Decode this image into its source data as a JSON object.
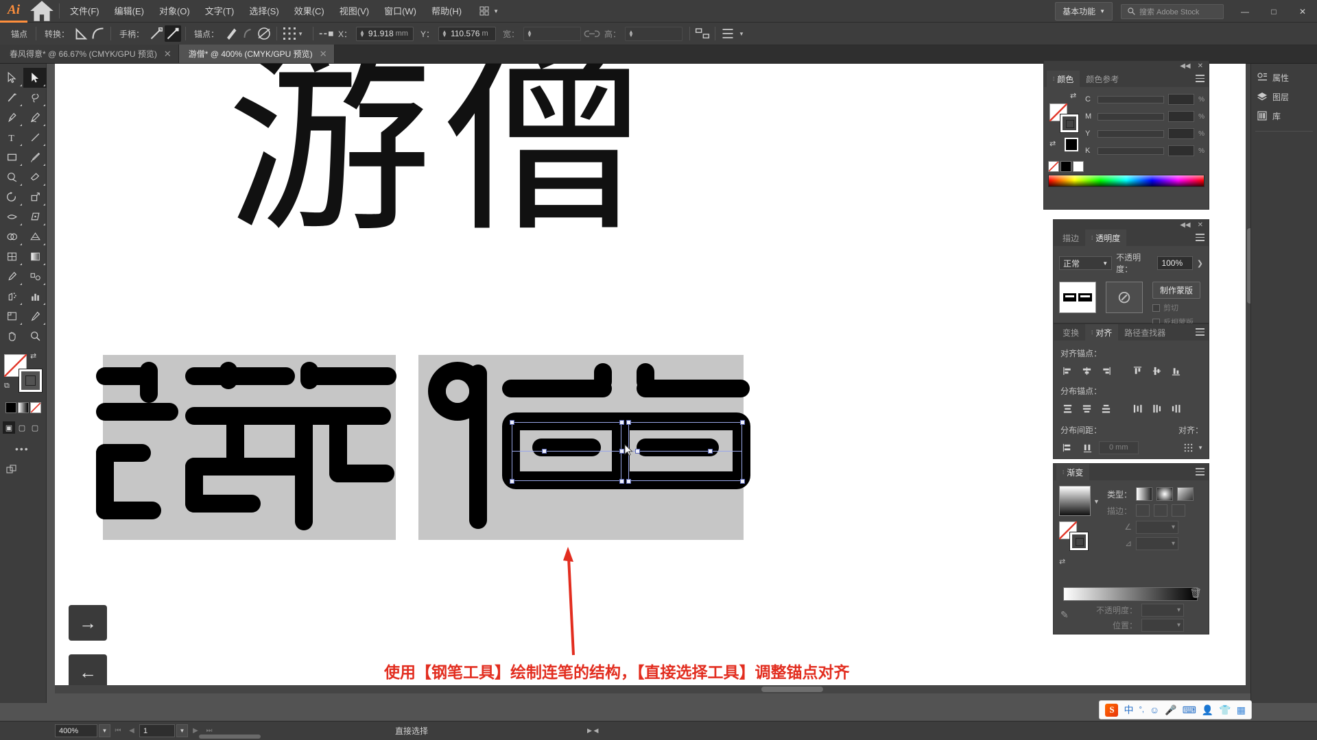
{
  "app": {
    "name": "Ai",
    "workspace": "基本功能",
    "stock_placeholder": "搜索 Adobe Stock"
  },
  "menubar": {
    "items": [
      {
        "label": "文件(F)"
      },
      {
        "label": "编辑(E)"
      },
      {
        "label": "对象(O)"
      },
      {
        "label": "文字(T)"
      },
      {
        "label": "选择(S)"
      },
      {
        "label": "效果(C)"
      },
      {
        "label": "视图(V)"
      },
      {
        "label": "窗口(W)"
      },
      {
        "label": "帮助(H)"
      }
    ],
    "home_icon": "home-icon",
    "grid_icon": "grid-icon",
    "minimize": "—",
    "maximize": "□",
    "close": "✕"
  },
  "controlbar": {
    "title": "锚点",
    "convert_label": "转换：",
    "handle_label": "手柄：",
    "anchor_label": "锚点：",
    "x_label": "X：",
    "x_value": "91.918",
    "x_unit": "mm",
    "y_label": "Y：",
    "y_value": "110.576",
    "y_unit": "m",
    "w_label": "宽：",
    "w_value": "",
    "h_label": "高：",
    "h_value": "",
    "icons": {
      "convert_corner": "convert-corner-icon",
      "convert_smooth": "convert-smooth-icon",
      "handle_show": "handle-show-icon",
      "handle_hide": "handle-hide-icon",
      "anchor_remove": "anchor-remove-icon",
      "anchor_connect": "anchor-connect-icon",
      "isolate": "isolate-icon",
      "align_grid": "align-grid-icon",
      "transform_ref": "transform-reference-icon",
      "link": "link-icon",
      "distribute": "distribute-icon",
      "more": "more-options-icon"
    }
  },
  "tabs": [
    {
      "label": "春风得意* @ 66.67% (CMYK/GPU 预览)",
      "active": false,
      "close": "✕"
    },
    {
      "label": "游僧* @ 400% (CMYK/GPU 预览)",
      "active": true,
      "close": "✕"
    }
  ],
  "toolbar": {
    "tools": [
      {
        "name": "selection-tool",
        "label": "选择工具"
      },
      {
        "name": "direct-selection-tool",
        "label": "直接选择工具",
        "selected": true
      },
      {
        "name": "magic-wand-tool",
        "label": "魔棒工具"
      },
      {
        "name": "lasso-tool",
        "label": "套索工具"
      },
      {
        "name": "pen-tool",
        "label": "钢笔工具"
      },
      {
        "name": "curvature-tool",
        "label": "曲率工具"
      },
      {
        "name": "type-tool",
        "label": "文字工具"
      },
      {
        "name": "line-segment-tool",
        "label": "直线段工具"
      },
      {
        "name": "rectangle-tool",
        "label": "矩形工具"
      },
      {
        "name": "paintbrush-tool",
        "label": "画笔工具"
      },
      {
        "name": "shaper-tool",
        "label": "Shaper 工具"
      },
      {
        "name": "eraser-tool",
        "label": "橡皮擦工具"
      },
      {
        "name": "rotate-tool",
        "label": "旋转工具"
      },
      {
        "name": "scale-tool",
        "label": "比例缩放工具"
      },
      {
        "name": "width-tool",
        "label": "宽度工具"
      },
      {
        "name": "free-transform-tool",
        "label": "自由变换工具"
      },
      {
        "name": "shape-builder-tool",
        "label": "形状生成器工具"
      },
      {
        "name": "perspective-grid-tool",
        "label": "透视网格工具"
      },
      {
        "name": "mesh-tool",
        "label": "网格工具"
      },
      {
        "name": "gradient-tool",
        "label": "渐变工具"
      },
      {
        "name": "eyedropper-tool",
        "label": "吸管工具"
      },
      {
        "name": "blend-tool",
        "label": "混合工具"
      },
      {
        "name": "symbol-sprayer-tool",
        "label": "符号喷枪工具"
      },
      {
        "name": "column-graph-tool",
        "label": "柱形图工具"
      },
      {
        "name": "artboard-tool",
        "label": "画板工具"
      },
      {
        "name": "slice-tool",
        "label": "切片工具"
      },
      {
        "name": "hand-tool",
        "label": "抓手工具"
      },
      {
        "name": "zoom-tool",
        "label": "缩放工具"
      }
    ],
    "fill_stroke": {
      "fill_name": "fill-swatch",
      "stroke_name": "stroke-swatch",
      "swap_icon": "swap-fill-stroke-icon",
      "default_icon": "default-fill-stroke-icon"
    },
    "color_modes": [
      "color-mode",
      "gradient-mode",
      "none-mode"
    ],
    "screen_modes": [
      "normal-screen-mode",
      "fullscreen-menubar-mode",
      "fullscreen-mode"
    ],
    "more_label": "•••"
  },
  "canvas": {
    "glyph_preview": "游僧",
    "artboard_color": "#c6c6c6",
    "caption": "使用【钢笔工具】绘制连笔的结构，【直接选择工具】调整锚点对齐",
    "caption_color": "#e22d1f",
    "arrow_color": "#e22d1f",
    "nav": {
      "next": "→",
      "prev": "←",
      "strip": [
        "→",
        "←",
        "←"
      ]
    }
  },
  "panels": {
    "color": {
      "tabs": [
        {
          "label": "颜色",
          "active": true
        },
        {
          "label": "颜色参考",
          "active": false
        }
      ],
      "channels": [
        {
          "label": "C",
          "value": "",
          "unit": "%"
        },
        {
          "label": "M",
          "value": "",
          "unit": "%"
        },
        {
          "label": "Y",
          "value": "",
          "unit": "%"
        },
        {
          "label": "K",
          "value": "",
          "unit": "%"
        }
      ],
      "menu_icon": "panel-menu-icon"
    },
    "transparency": {
      "tabs": [
        {
          "label": "描边",
          "active": false
        },
        {
          "label": "透明度",
          "active": true
        }
      ],
      "blend_mode": "正常",
      "opacity_label": "不透明度：",
      "opacity_value": "100%",
      "make_mask_button": "制作蒙版",
      "clip_label": "剪切",
      "invert_label": "反相蒙版",
      "arrow": "❯"
    },
    "align": {
      "tabs": [
        {
          "label": "变换",
          "active": false
        },
        {
          "label": "对齐",
          "active": true
        },
        {
          "label": "路径查找器",
          "active": false
        }
      ],
      "align_anchors_label": "对齐锚点：",
      "distribute_anchors_label": "分布锚点：",
      "distribute_spacing_label": "分布间距：",
      "align_to_label": "对齐：",
      "spacing_value": "0 mm"
    },
    "gradient": {
      "tabs": [
        {
          "label": "渐变",
          "active": true
        }
      ],
      "type_label": "类型：",
      "stroke_label": "描边：",
      "angle_label": "角度",
      "aspect_label": "长宽比",
      "opacity_label": "不透明度：",
      "location_label": "位置：",
      "types": [
        "linear-gradient-type",
        "radial-gradient-type",
        "freeform-gradient-type"
      ]
    }
  },
  "dock": {
    "items": [
      {
        "label": "属性",
        "icon": "properties-icon"
      },
      {
        "label": "图层",
        "icon": "layers-icon"
      },
      {
        "label": "库",
        "icon": "libraries-icon"
      }
    ]
  },
  "statusbar": {
    "zoom": "400%",
    "page": "1",
    "tool_name": "直接选择",
    "first_icon": "⏮",
    "prev_icon": "◀",
    "next_icon": "▶",
    "last_icon": "⏭"
  },
  "ime": {
    "logo": "S",
    "mode": "中",
    "punctuation": "°,",
    "icons": [
      "emoji-icon",
      "microphone-icon",
      "keyboard-icon",
      "user-icon",
      "skin-icon",
      "apps-icon"
    ]
  }
}
